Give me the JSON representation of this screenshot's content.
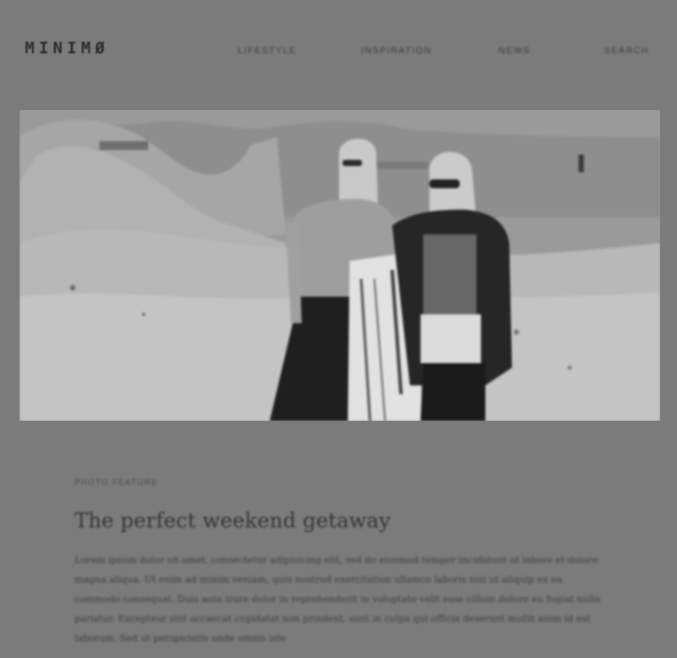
{
  "brand": {
    "logo_text": "MINIMØ"
  },
  "nav": {
    "items": [
      {
        "label": "Lifestyle"
      },
      {
        "label": "Inspiration"
      },
      {
        "label": "News"
      },
      {
        "label": "Search"
      }
    ]
  },
  "hero": {
    "alt": "Two women standing in a rocky desert landscape"
  },
  "article": {
    "kicker": "Photo Feature",
    "title": "The perfect weekend getaway",
    "body": "Lorem ipsum dolor sit amet, consectetur adipisicing elit, sed do eiusmod tempor incididunt ut labore et dolore magna aliqua. Ut enim ad minim veniam, quis nostrud exercitation ullamco laboris nisi ut aliquip ex ea commodo consequat. Duis aute irure dolor in reprehenderit in voluptate velit esse cillum dolore eu fugiat nulla pariatur. Excepteur sint occaecat cupidatat non proident, sunt in culpa qui officia deserunt mollit anim id est laborum. Sed ut perspiciatis unde omnis iste"
  },
  "colors": {
    "overlay": "#7b7b7b",
    "text": "#3a3a3a"
  }
}
